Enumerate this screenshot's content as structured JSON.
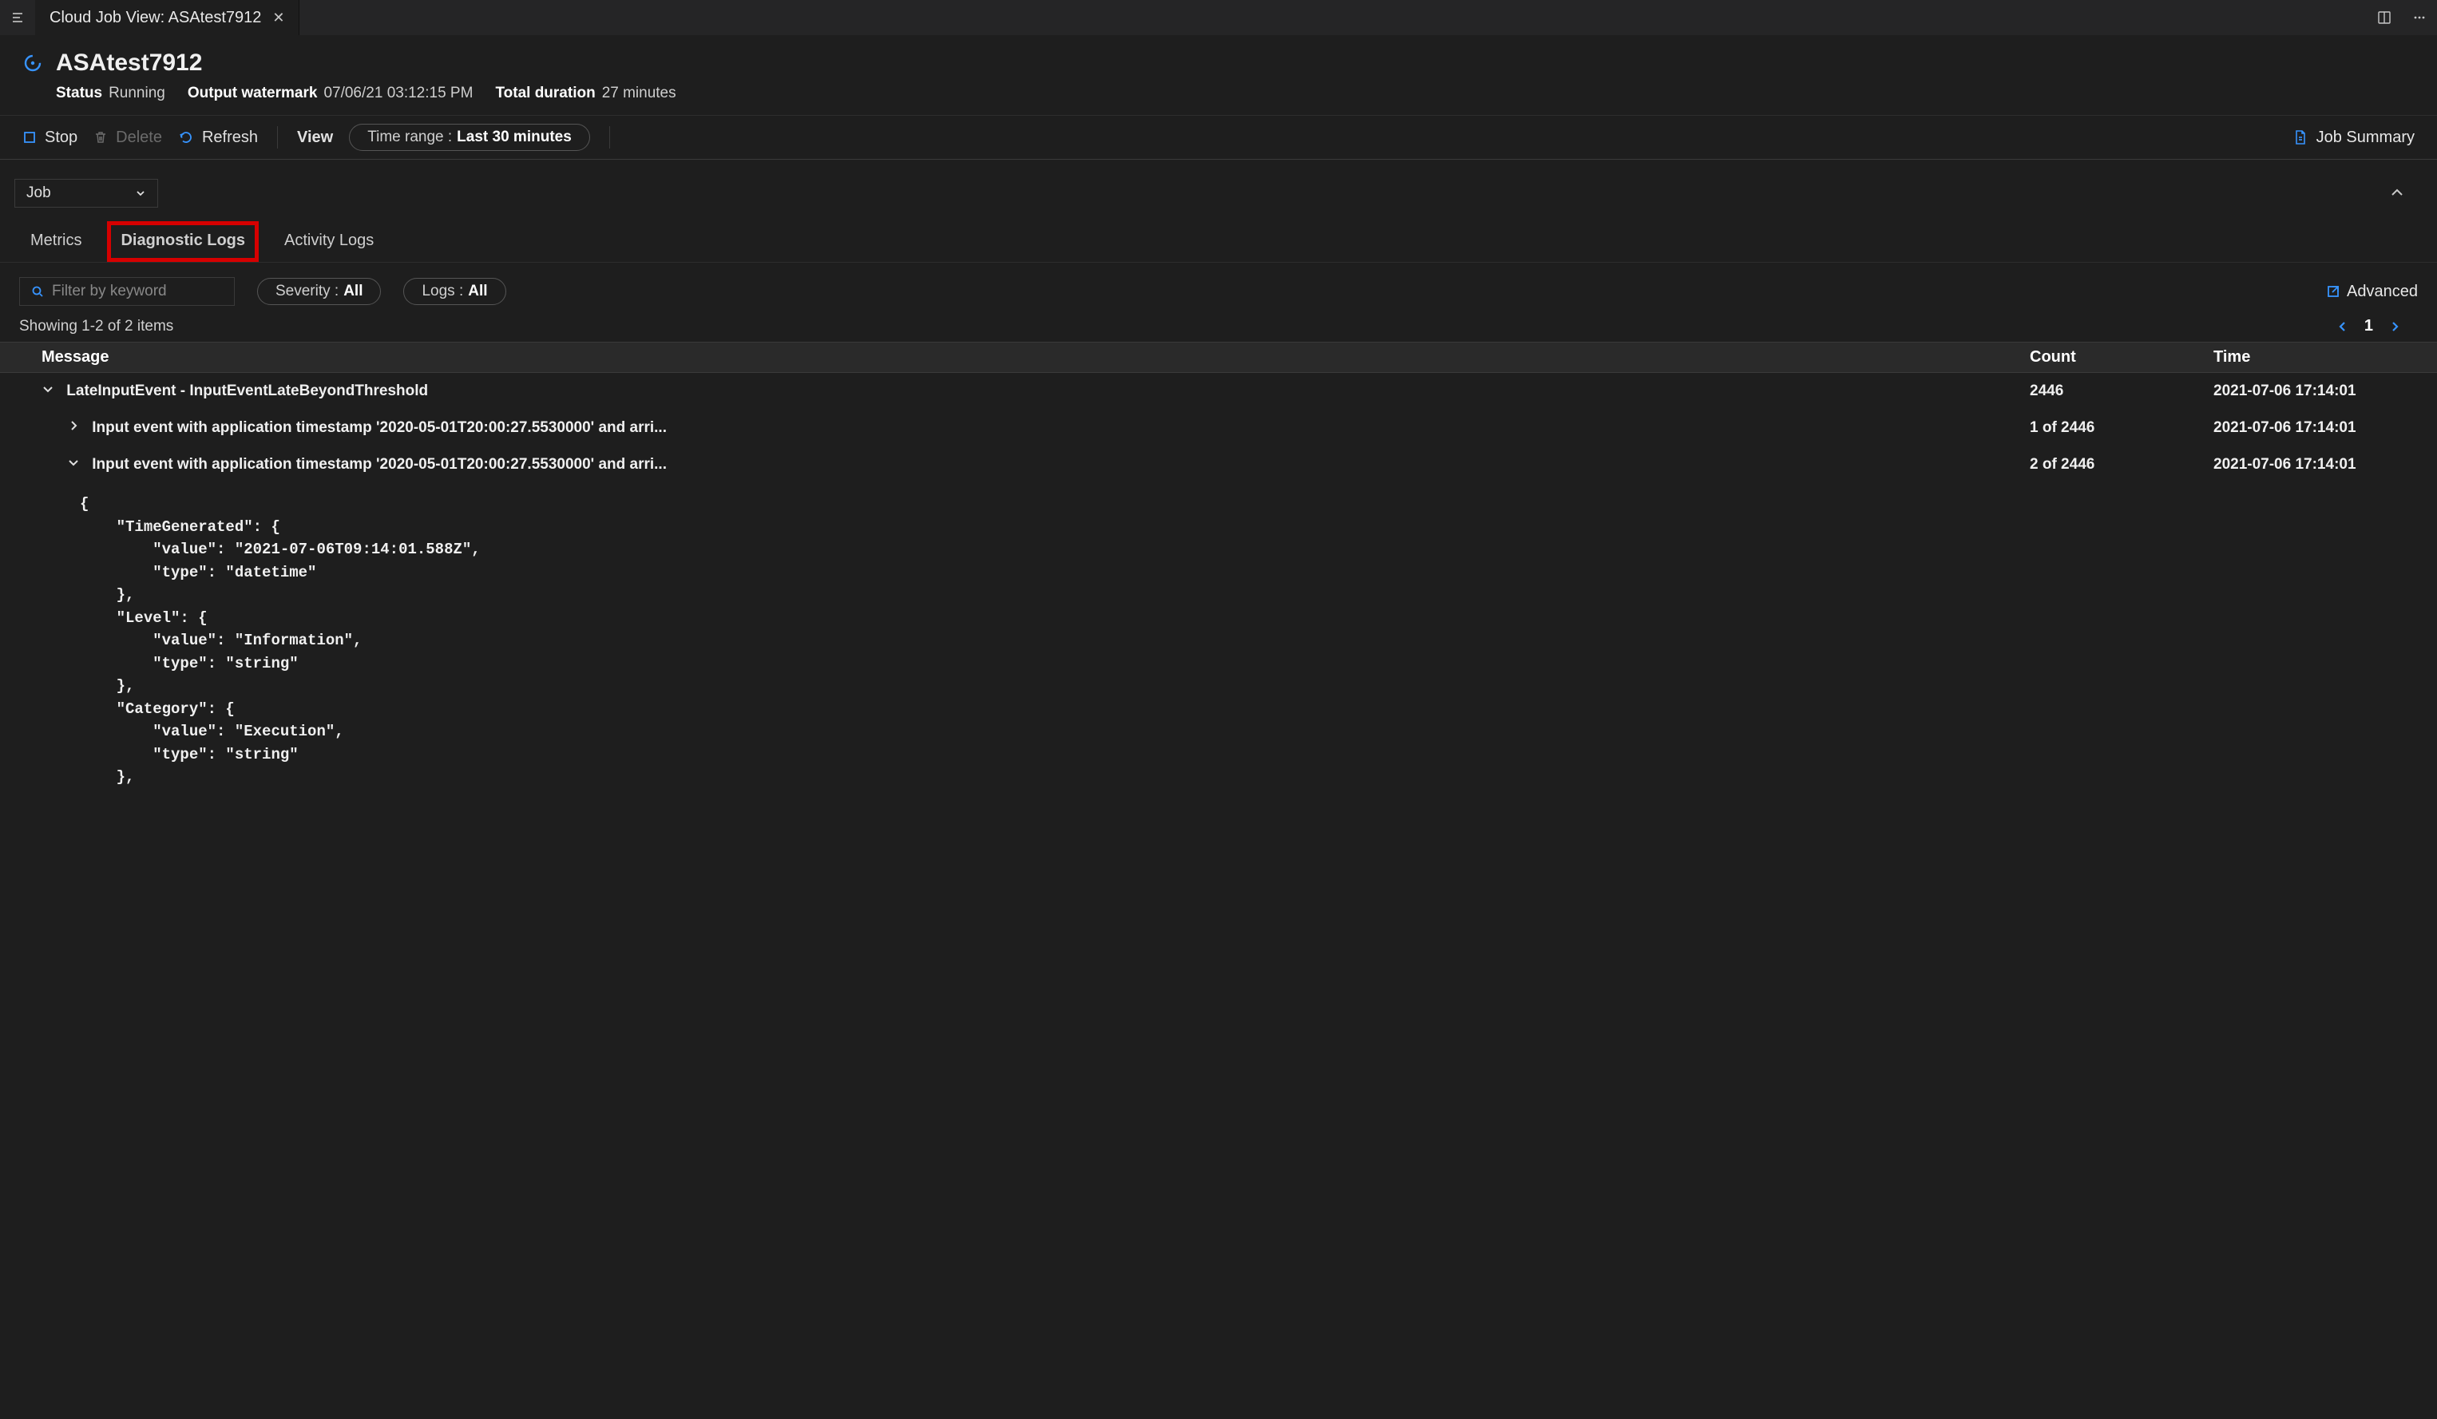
{
  "tabstrip": {
    "tab_label": "Cloud Job View: ASAtest7912"
  },
  "header": {
    "title": "ASAtest7912",
    "status_label": "Status",
    "status_value": "Running",
    "watermark_label": "Output watermark",
    "watermark_value": "07/06/21 03:12:15 PM",
    "duration_label": "Total duration",
    "duration_value": "27 minutes"
  },
  "toolbar": {
    "stop": "Stop",
    "delete": "Delete",
    "refresh": "Refresh",
    "view": "View",
    "timerange_label": "Time range :",
    "timerange_value": "Last 30 minutes",
    "job_summary": "Job Summary"
  },
  "subbar": {
    "scope": "Job"
  },
  "tabs": {
    "metrics": "Metrics",
    "diagnostic": "Diagnostic Logs",
    "activity": "Activity Logs"
  },
  "filters": {
    "search_placeholder": "Filter by keyword",
    "severity_label": "Severity :",
    "severity_value": "All",
    "logs_label": "Logs :",
    "logs_value": "All",
    "advanced": "Advanced"
  },
  "status": {
    "showing": "Showing 1-2 of 2 items",
    "page": "1"
  },
  "table": {
    "head_message": "Message",
    "head_count": "Count",
    "head_time": "Time",
    "rows": [
      {
        "expanded": true,
        "level": 0,
        "message": "LateInputEvent - InputEventLateBeyondThreshold",
        "count": "2446",
        "time": "2021-07-06 17:14:01"
      },
      {
        "expanded": false,
        "level": 1,
        "message": "Input event with application timestamp '2020-05-01T20:00:27.5530000' and arri...",
        "count": "1 of 2446",
        "time": "2021-07-06 17:14:01"
      },
      {
        "expanded": true,
        "level": 1,
        "message": "Input event with application timestamp '2020-05-01T20:00:27.5530000' and arri...",
        "count": "2 of 2446",
        "time": "2021-07-06 17:14:01"
      }
    ],
    "json_detail": "{\n    \"TimeGenerated\": {\n        \"value\": \"2021-07-06T09:14:01.588Z\",\n        \"type\": \"datetime\"\n    },\n    \"Level\": {\n        \"value\": \"Information\",\n        \"type\": \"string\"\n    },\n    \"Category\": {\n        \"value\": \"Execution\",\n        \"type\": \"string\"\n    },"
  }
}
